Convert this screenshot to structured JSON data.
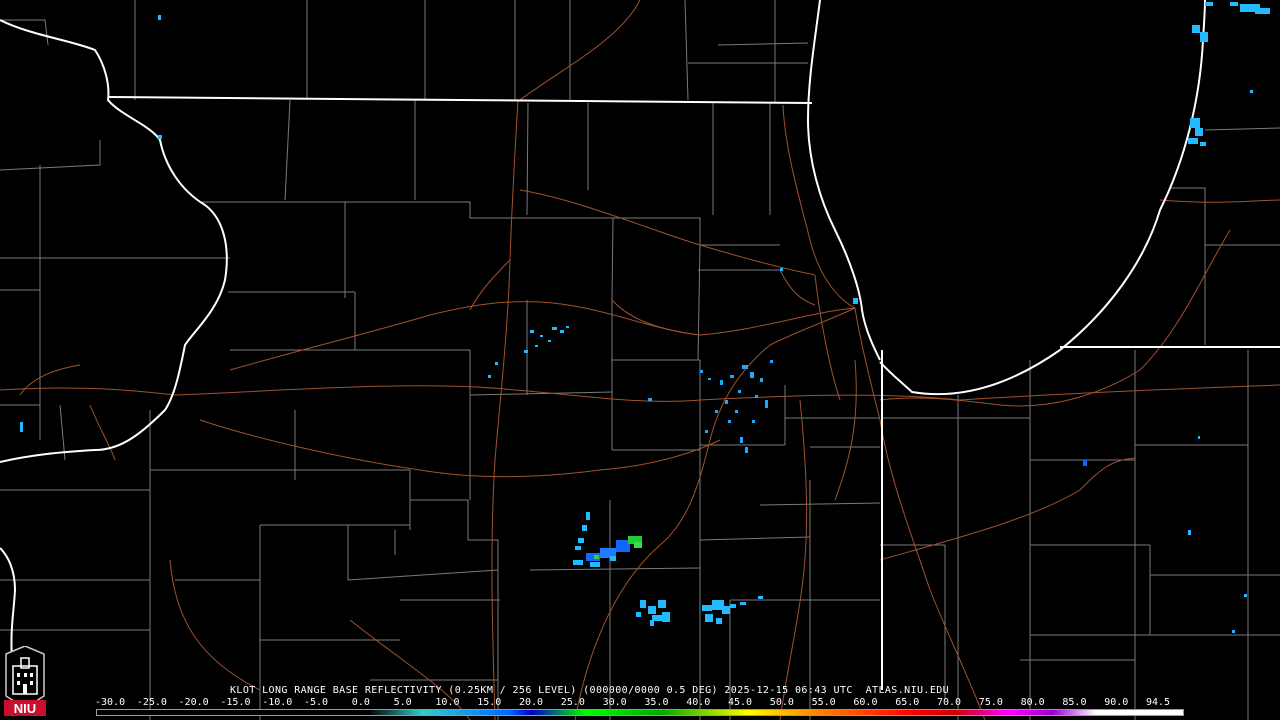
{
  "product": {
    "title": "KLOT LONG RANGE BASE REFLECTIVITY (0.25KM / 256 LEVEL) (000000/0000 0.5 DEG) 2025-12-15 06:43 UTC  ATLAS.NIU.EDU"
  },
  "scale": {
    "labels": [
      "-30.0",
      "-25.0",
      "-20.0",
      "-15.0",
      "-10.0",
      "-5.0",
      "0.0",
      "5.0",
      "10.0",
      "15.0",
      "20.0",
      "25.0",
      "30.0",
      "35.0",
      "40.0",
      "45.0",
      "50.0",
      "55.0",
      "60.0",
      "65.0",
      "70.0",
      "75.0",
      "80.0",
      "85.0",
      "90.0",
      "94.5"
    ]
  },
  "logo": {
    "text": "NIU"
  },
  "colors": {
    "background": "#000000",
    "state_border": "#ffffff",
    "county_border": "#808080",
    "highway": "#a0522d",
    "radar_light": "#22bbff",
    "radar_medium": "#1166ff",
    "radar_heavy": "#22cc33"
  }
}
